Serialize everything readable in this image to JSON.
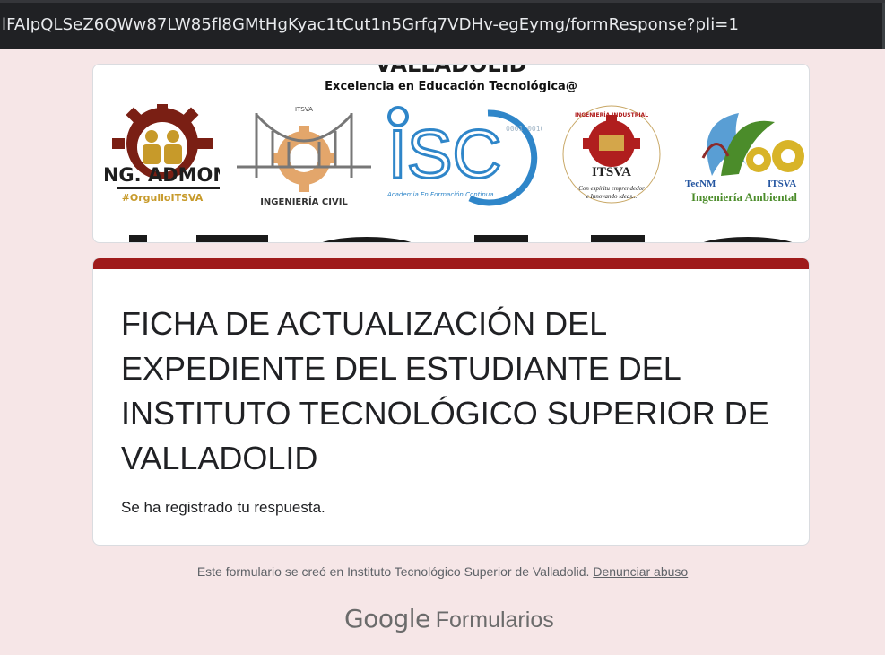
{
  "browser": {
    "url": "lFAIpQLSeZ6QWw87LW85fl8GMtHgKyac1tCut1n5Grfq7VDHv-egEymg/formResponse?pli=1"
  },
  "banner": {
    "top_text": "VALLADOLID",
    "slogan": "Excelencia en Educación Tecnológica@",
    "logos": [
      {
        "name": "ing-admon-logo",
        "line1": "ING. ADMON",
        "line2": "#OrgulloITSVA"
      },
      {
        "name": "ingenieria-civil-logo",
        "top": "ITSVA",
        "label": "INGENIERÍA CIVIL"
      },
      {
        "name": "isc-logo",
        "label": "ISC",
        "sub": "Academia En Formación Continua",
        "bits": "0001 0010 1100"
      },
      {
        "name": "ingenieria-industrial-logo",
        "arc": "INGENIERÍA INDUSTRIAL",
        "label": "ITSVA",
        "sub1": "Con espíritu emprendedor",
        "sub2": "e Innovando ideas..."
      },
      {
        "name": "ingenieria-ambiental-logo",
        "left": "TecNM",
        "right": "ITSVA",
        "label": "Ingeniería Ambiental"
      }
    ],
    "colors": {
      "maroon": "#7a1f14",
      "gold": "#c79a2a",
      "blue": "#2f86c9",
      "red": "#b01e1e",
      "green": "#4b8c2a"
    }
  },
  "form": {
    "title": "FICHA DE ACTUALIZACIÓN DEL EXPEDIENTE DEL ESTUDIANTE DEL INSTITUTO TECNOLÓGICO SUPERIOR DE VALLADOLID",
    "confirmation": "Se ha registrado tu respuesta.",
    "accent_color": "#9f1b1b"
  },
  "footer": {
    "note": "Este formulario se creó en Instituto Tecnológico Superior de Valladolid.",
    "report_link": "Denunciar abuso",
    "brand_google": "Google",
    "brand_product": "Formularios"
  }
}
